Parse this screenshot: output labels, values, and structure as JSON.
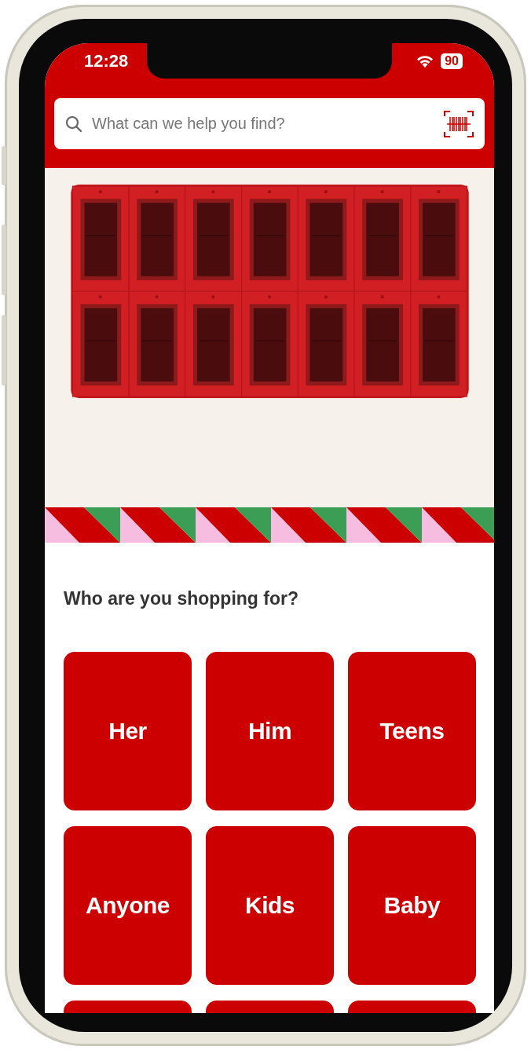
{
  "status_bar": {
    "time": "12:28",
    "battery": "90"
  },
  "search": {
    "placeholder": "What can we help you find?"
  },
  "section": {
    "title": "Who are you shopping for?"
  },
  "categories": [
    {
      "label": "Her"
    },
    {
      "label": "Him"
    },
    {
      "label": "Teens"
    },
    {
      "label": "Anyone"
    },
    {
      "label": "Kids"
    },
    {
      "label": "Baby"
    }
  ]
}
